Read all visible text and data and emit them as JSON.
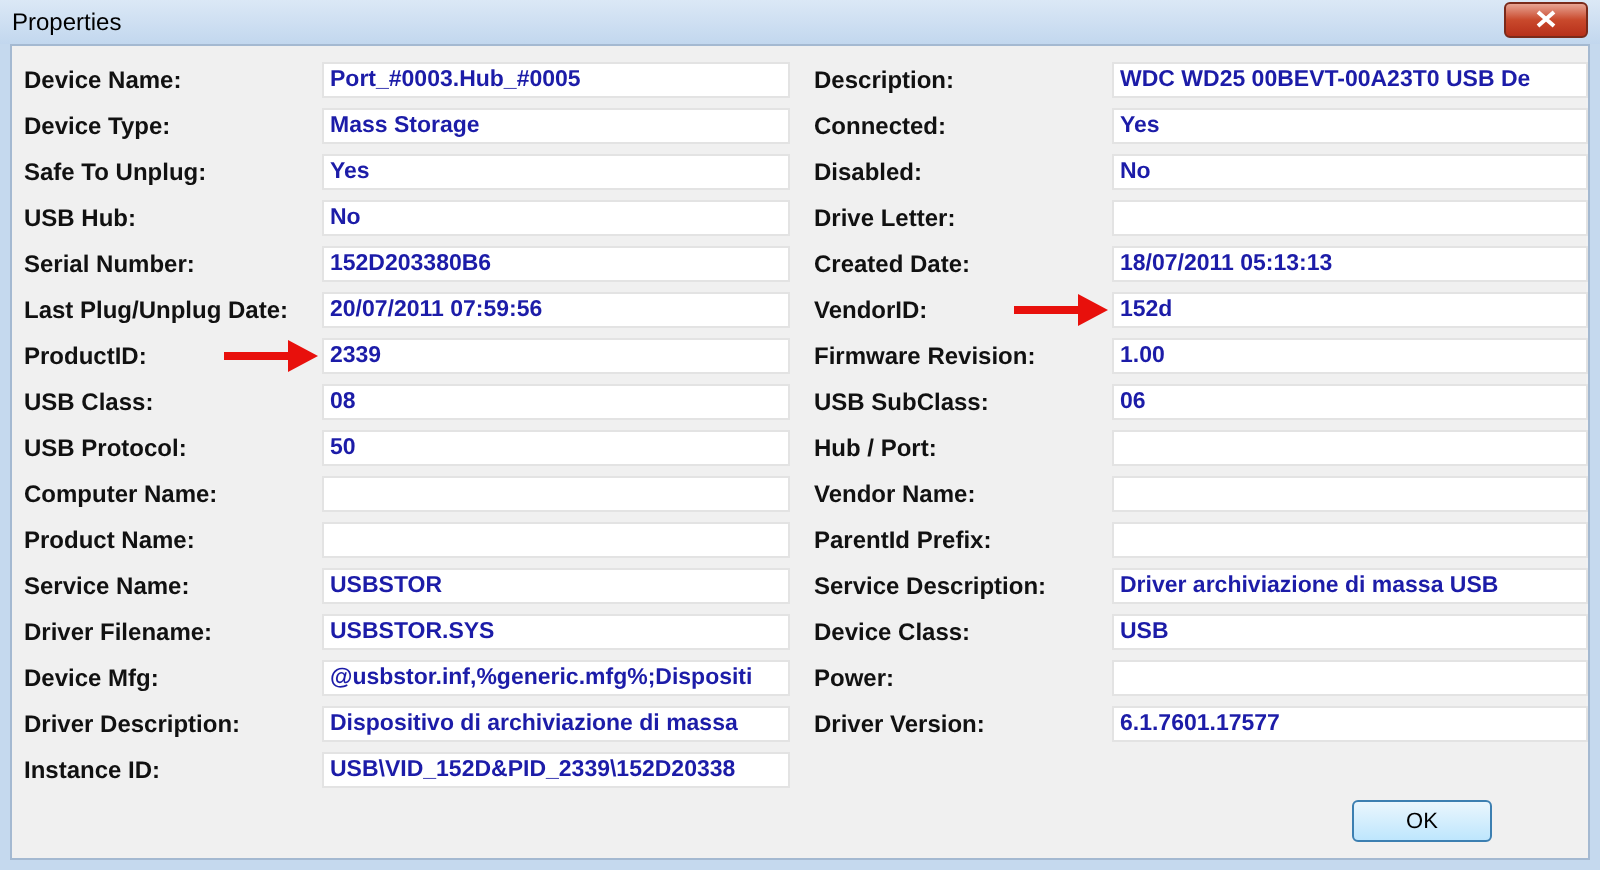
{
  "window": {
    "title": "Properties"
  },
  "left": [
    {
      "label": "Device Name:",
      "value": "Port_#0003.Hub_#0005",
      "marked": false
    },
    {
      "label": "Device Type:",
      "value": "Mass Storage",
      "marked": false
    },
    {
      "label": "Safe To Unplug:",
      "value": "Yes",
      "marked": false
    },
    {
      "label": "USB Hub:",
      "value": "No",
      "marked": false
    },
    {
      "label": "Serial Number:",
      "value": "152D203380B6",
      "marked": false
    },
    {
      "label": "Last Plug/Unplug Date:",
      "value": "20/07/2011 07:59:56",
      "marked": false
    },
    {
      "label": "ProductID:",
      "value": "2339",
      "marked": true
    },
    {
      "label": "USB Class:",
      "value": "08",
      "marked": false
    },
    {
      "label": "USB Protocol:",
      "value": "50",
      "marked": false
    },
    {
      "label": "Computer Name:",
      "marked": false
    },
    {
      "label": "Product Name:",
      "marked": false
    },
    {
      "label": "Service Name:",
      "value": "USBSTOR",
      "marked": false
    },
    {
      "label": "Driver Filename:",
      "value": "USBSTOR.SYS",
      "marked": false
    },
    {
      "label": "Device Mfg:",
      "value": "@usbstor.inf,%generic.mfg%;Dispositi",
      "marked": false
    },
    {
      "label": "Driver Description:",
      "value": "Dispositivo di archiviazione di massa",
      "marked": false
    },
    {
      "label": "Instance ID:",
      "value": "USB\\VID_152D&PID_2339\\152D20338",
      "marked": false
    }
  ],
  "right": [
    {
      "label": "Description:",
      "value": "WDC WD25 00BEVT-00A23T0 USB De",
      "marked": false
    },
    {
      "label": "Connected:",
      "value": "Yes",
      "marked": false
    },
    {
      "label": "Disabled:",
      "value": "No",
      "marked": false
    },
    {
      "label": "Drive Letter:",
      "marked": false
    },
    {
      "label": "Created Date:",
      "value": "18/07/2011 05:13:13",
      "marked": false
    },
    {
      "label": "VendorID:",
      "value": "152d",
      "marked": true
    },
    {
      "label": "Firmware Revision:",
      "value": "1.00",
      "marked": false
    },
    {
      "label": "USB SubClass:",
      "value": "06",
      "marked": false
    },
    {
      "label": "Hub / Port:",
      "marked": false
    },
    {
      "label": "Vendor Name:",
      "marked": false
    },
    {
      "label": "ParentId Prefix:",
      "marked": false
    },
    {
      "label": "Service Description:",
      "value": "Driver archiviazione di massa USB",
      "marked": false
    },
    {
      "label": "Device Class:",
      "value": "USB",
      "marked": false
    },
    {
      "label": "Power:",
      "marked": false
    },
    {
      "label": "Driver Version:",
      "value": "6.1.7601.17577",
      "marked": false
    }
  ],
  "buttons": [
    "OK"
  ]
}
